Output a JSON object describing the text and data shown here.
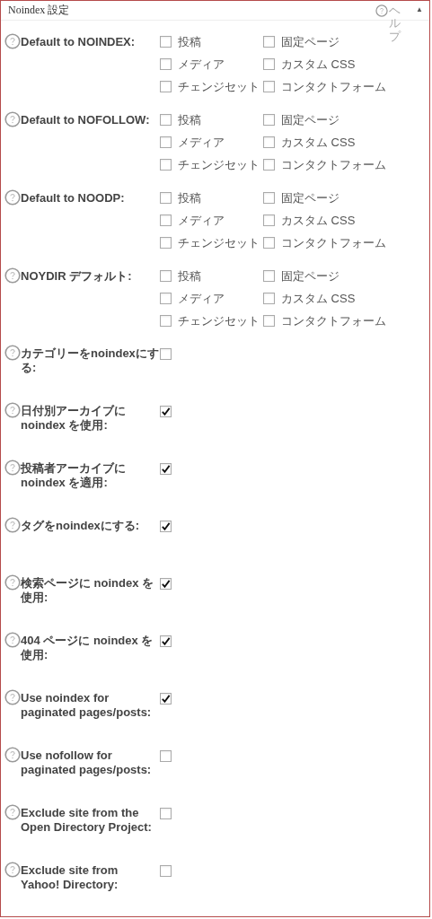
{
  "panel": {
    "title": "Noindex 設定",
    "help": "ヘルプ",
    "collapse": "▲"
  },
  "settings": [
    {
      "kind": "multi",
      "label": "Default to NOINDEX:",
      "options": [
        {
          "label": "投稿",
          "checked": false
        },
        {
          "label": "固定ページ",
          "checked": false
        },
        {
          "label": "メディア",
          "checked": false
        },
        {
          "label": "カスタム CSS",
          "checked": false
        },
        {
          "label": "チェンジセット",
          "checked": false
        },
        {
          "label": "コンタクトフォーム",
          "checked": false
        }
      ]
    },
    {
      "kind": "multi",
      "label": "Default to NOFOLLOW:",
      "options": [
        {
          "label": "投稿",
          "checked": false
        },
        {
          "label": "固定ページ",
          "checked": false
        },
        {
          "label": "メディア",
          "checked": false
        },
        {
          "label": "カスタム CSS",
          "checked": false
        },
        {
          "label": "チェンジセット",
          "checked": false
        },
        {
          "label": "コンタクトフォーム",
          "checked": false
        }
      ]
    },
    {
      "kind": "multi",
      "label": "Default to NOODP:",
      "options": [
        {
          "label": "投稿",
          "checked": false
        },
        {
          "label": "固定ページ",
          "checked": false
        },
        {
          "label": "メディア",
          "checked": false
        },
        {
          "label": "カスタム CSS",
          "checked": false
        },
        {
          "label": "チェンジセット",
          "checked": false
        },
        {
          "label": "コンタクトフォーム",
          "checked": false
        }
      ]
    },
    {
      "kind": "multi",
      "label": "NOYDIR デフォルト:",
      "options": [
        {
          "label": "投稿",
          "checked": false
        },
        {
          "label": "固定ページ",
          "checked": false
        },
        {
          "label": "メディア",
          "checked": false
        },
        {
          "label": "カスタム CSS",
          "checked": false
        },
        {
          "label": "チェンジセット",
          "checked": false
        },
        {
          "label": "コンタクトフォーム",
          "checked": false
        }
      ]
    },
    {
      "kind": "single",
      "label": "カテゴリーをnoindexにする:",
      "checked": false
    },
    {
      "kind": "single",
      "label": "日付別アーカイブに noindex を使用:",
      "checked": true
    },
    {
      "kind": "single",
      "label": "投稿者アーカイブに noindex を適用:",
      "checked": true
    },
    {
      "kind": "single",
      "label": "タグをnoindexにする:",
      "checked": true
    },
    {
      "kind": "single",
      "label": "検索ページに noindex を使用:",
      "checked": true
    },
    {
      "kind": "single",
      "label": "404 ページに noindex を使用:",
      "checked": true
    },
    {
      "kind": "single",
      "label": "Use noindex for paginated pages/posts:",
      "checked": true
    },
    {
      "kind": "single",
      "label": "Use nofollow for paginated pages/posts:",
      "checked": false
    },
    {
      "kind": "single",
      "label": "Exclude site from the Open Directory Project:",
      "checked": false
    },
    {
      "kind": "single",
      "label": "Exclude site from Yahoo! Directory:",
      "checked": false
    }
  ]
}
